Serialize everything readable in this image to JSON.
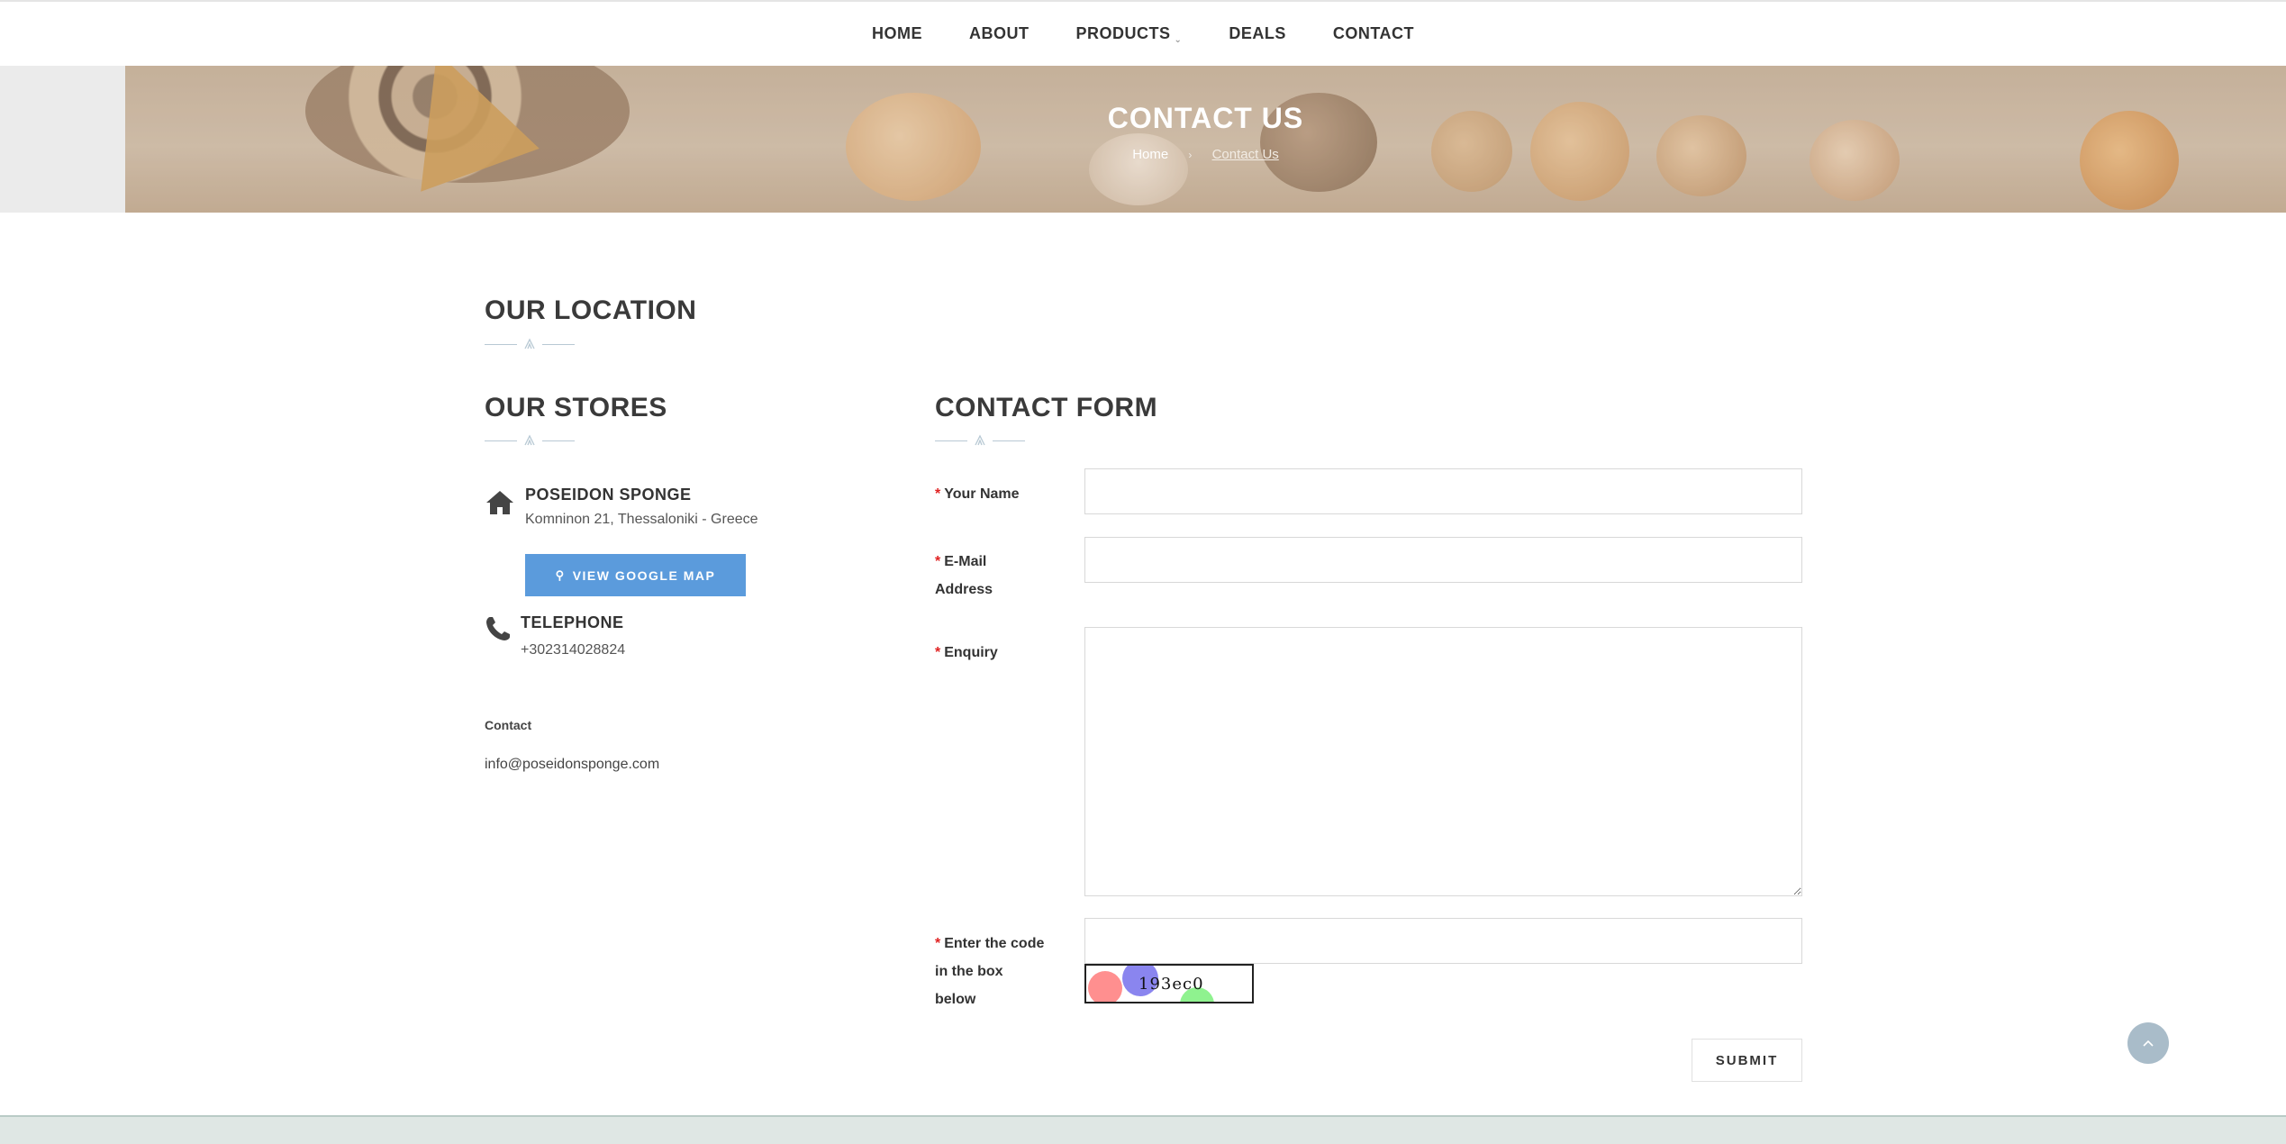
{
  "nav": {
    "items": [
      "HOME",
      "ABOUT",
      "PRODUCTS",
      "DEALS",
      "CONTACT"
    ]
  },
  "banner": {
    "title": "CONTACT US",
    "breadcrumb_home": "Home",
    "breadcrumb_current": "Contact Us"
  },
  "location": {
    "heading": "OUR LOCATION"
  },
  "stores": {
    "heading": "OUR STORES",
    "store_name": "POSEIDON SPONGE",
    "store_address": "Komninon 21, Thessaloniki - Greece",
    "map_button": "VIEW GOOGLE MAP",
    "telephone_label": "TELEPHONE",
    "telephone_value": "+302314028824",
    "contact_label": "Contact",
    "contact_email": "info@poseidonsponge.com"
  },
  "form": {
    "heading": "CONTACT FORM",
    "name_label": "Your Name",
    "email_label_line1": "E-Mail",
    "email_label_line2": "Address",
    "enquiry_label": "Enquiry",
    "captcha_label_line1": "Enter the code",
    "captcha_label_line2": "in the box",
    "captcha_label_line3": "below",
    "captcha_code": "193ec0",
    "required_mark": "*",
    "submit": "SUBMIT"
  },
  "colors": {
    "accent_button": "#5b9bdc",
    "required": "#e02222",
    "scroll_top": "#a9bcc9"
  }
}
